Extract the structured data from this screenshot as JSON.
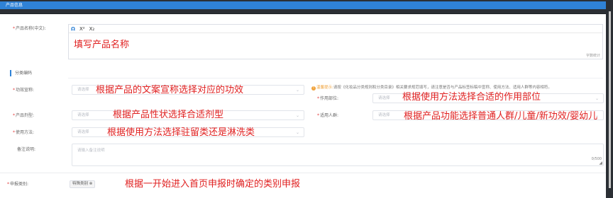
{
  "panel": {
    "title": "产品信息"
  },
  "product_name": {
    "label": "产品名称(中文):",
    "toolbar": [
      "Ω",
      "X²",
      "X₂"
    ],
    "word_count": "字数统计",
    "annotation": "填写产品名称"
  },
  "section": {
    "title": "分类编码"
  },
  "notice": {
    "warn": "温馨提示:",
    "text": "请按《化妆品分类规则和分类目录》相关要求规范填写，请注意是否与产品标签标稿中宣称、使用方法、适用人群等内容相符。"
  },
  "fields": {
    "efficacy": {
      "label": "功效宣称:",
      "placeholder": "请选择",
      "annotation": "根据产品的文案宣称选择对应的功效"
    },
    "area": {
      "label": "作用部位:",
      "placeholder": "请选择",
      "annotation": "根据使用方法选择合适的作用部位"
    },
    "dosage": {
      "label": "产品剂型:",
      "placeholder": "请选择",
      "annotation": "根据产品性状选择合适剂型"
    },
    "people": {
      "label": "适用人群:",
      "placeholder": "请选择",
      "annotation": "根据产品功能选择普通人群/儿童/新功效/婴幼儿"
    },
    "usage": {
      "label": "使用方法:",
      "placeholder": "请选择",
      "annotation": "根据使用方法选择驻留类还是淋洗类"
    },
    "remark": {
      "label": "备注说明:",
      "placeholder": "请输入备注说明",
      "count": "0/500"
    }
  },
  "declare": {
    "label": "申报类别:",
    "tag": "特殊类别 ⊗",
    "annotation": "根据一开始进入首页申报时确定的类别申报"
  }
}
